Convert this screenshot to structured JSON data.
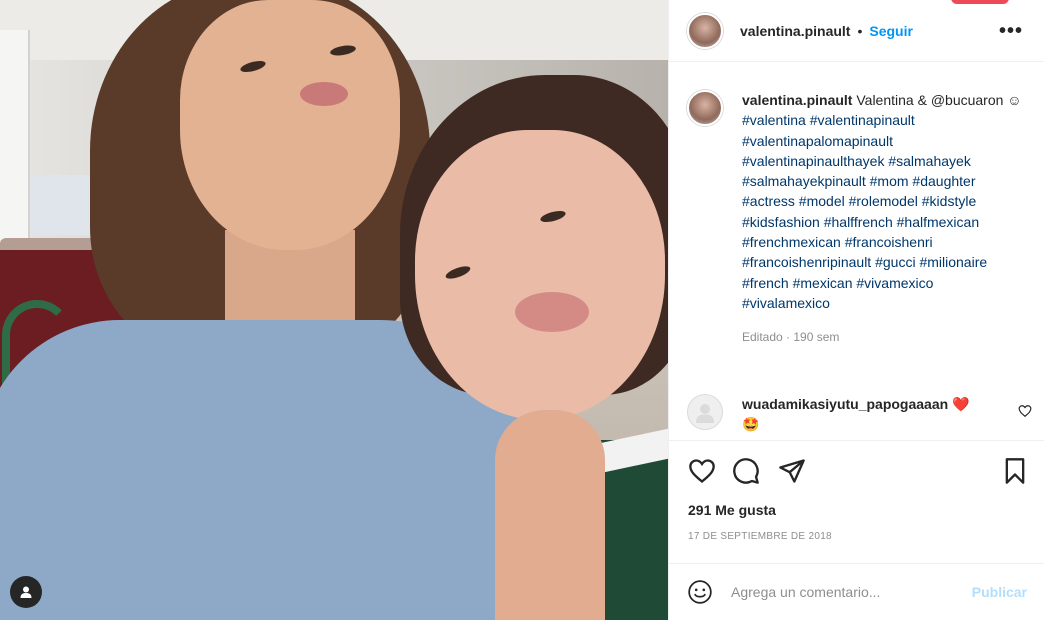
{
  "post": {
    "username": "valentina.pinault",
    "dot": "•",
    "follow_label": "Seguir",
    "more_icon": "more-horizontal-icon"
  },
  "caption": {
    "username": "valentina.pinault",
    "text": "Valentina & @bucuaron ☺",
    "hashtags": "#valentina #valentinapinault #valentinapalomapinault #valentinapinaulthayek #salmahayek #salmahayekpinault #mom #daughter #actress #model #rolemodel #kidstyle #kidsfashion #halffrench #halfmexican #frenchmexican #francoishenri #francoishenripinault #gucci #milionaire #french #mexican #vivamexico #vivalamexico",
    "meta": "Editado · 190 sem"
  },
  "comment": {
    "username": "wuadamikasiyutu_papogaaaan",
    "emoji_heart": "❤️",
    "emoji_face": "🤩"
  },
  "actions": {
    "like_icon": "heart-icon",
    "comment_icon": "comment-icon",
    "share_icon": "send-icon",
    "save_icon": "bookmark-icon"
  },
  "likes": "291 Me gusta",
  "date": "17 DE SEPTIEMBRE DE 2018",
  "add_comment": {
    "placeholder": "Agrega un comentario...",
    "publish_label": "Publicar"
  },
  "colors": {
    "accent": "#0095f6",
    "publish_disabled": "#b2dffc",
    "hashtag": "#00376b",
    "muted": "#8e8e8e",
    "heart_red": "#ed4956"
  }
}
